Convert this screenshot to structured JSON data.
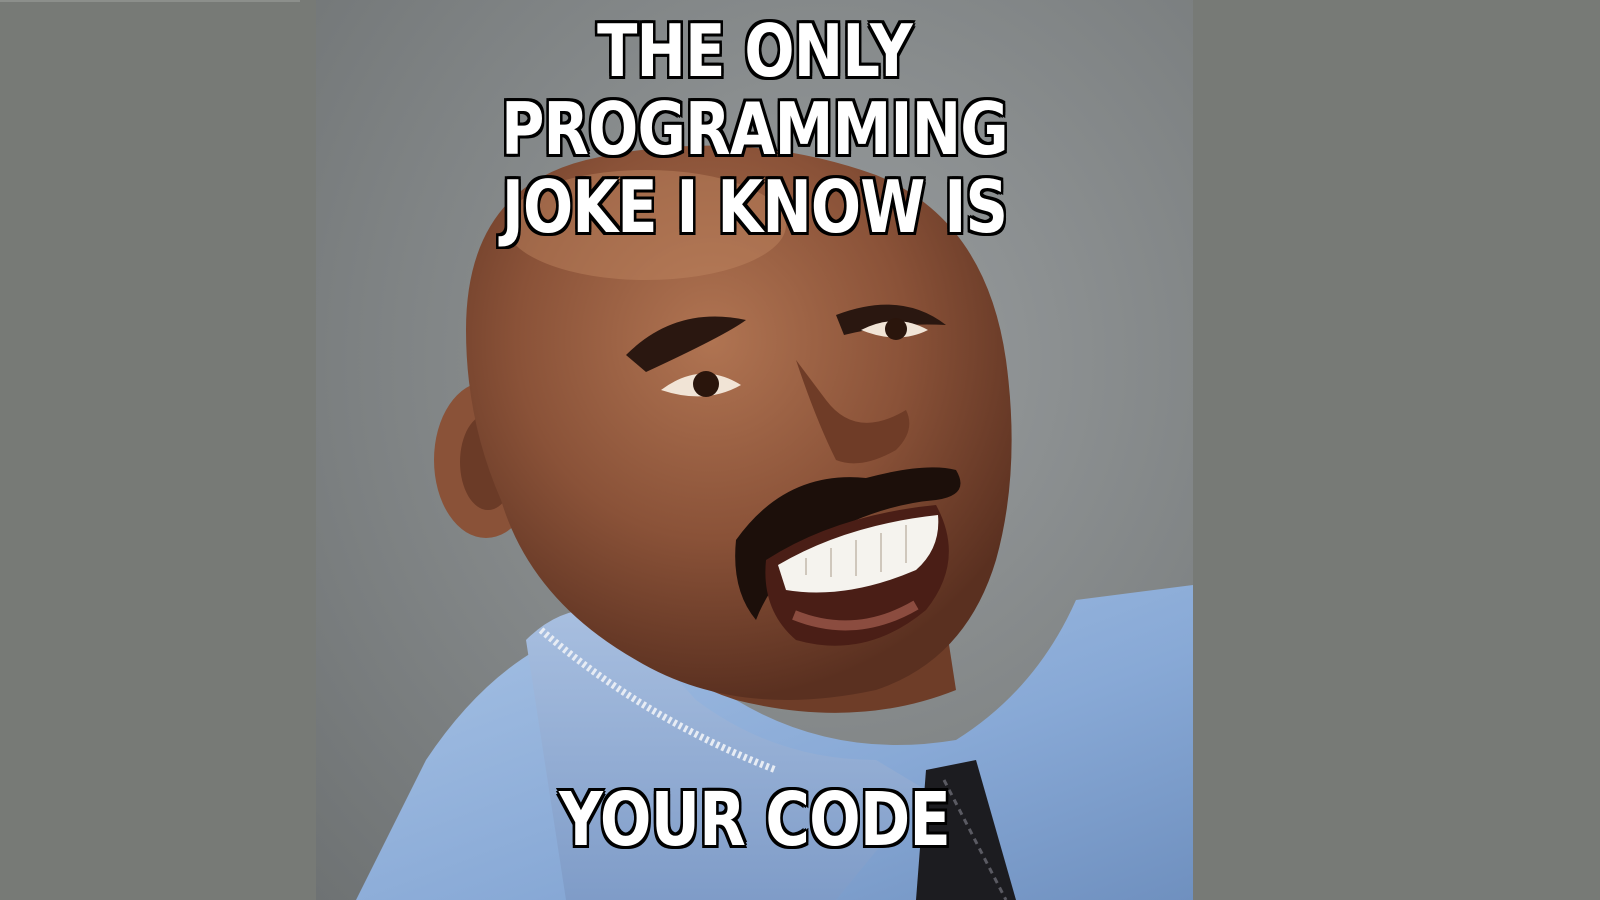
{
  "meme": {
    "top_text_line1": "THE ONLY PROGRAMMING",
    "top_text_line2": "JOKE I KNOW IS",
    "bottom_text": "YOUR CODE"
  },
  "colors": {
    "letterbox": "#777a76",
    "backdrop": "#868a8b",
    "suit": "#8fb1dc",
    "skin": "#8a5238",
    "caption_fill": "#ffffff",
    "caption_outline": "#000000"
  }
}
